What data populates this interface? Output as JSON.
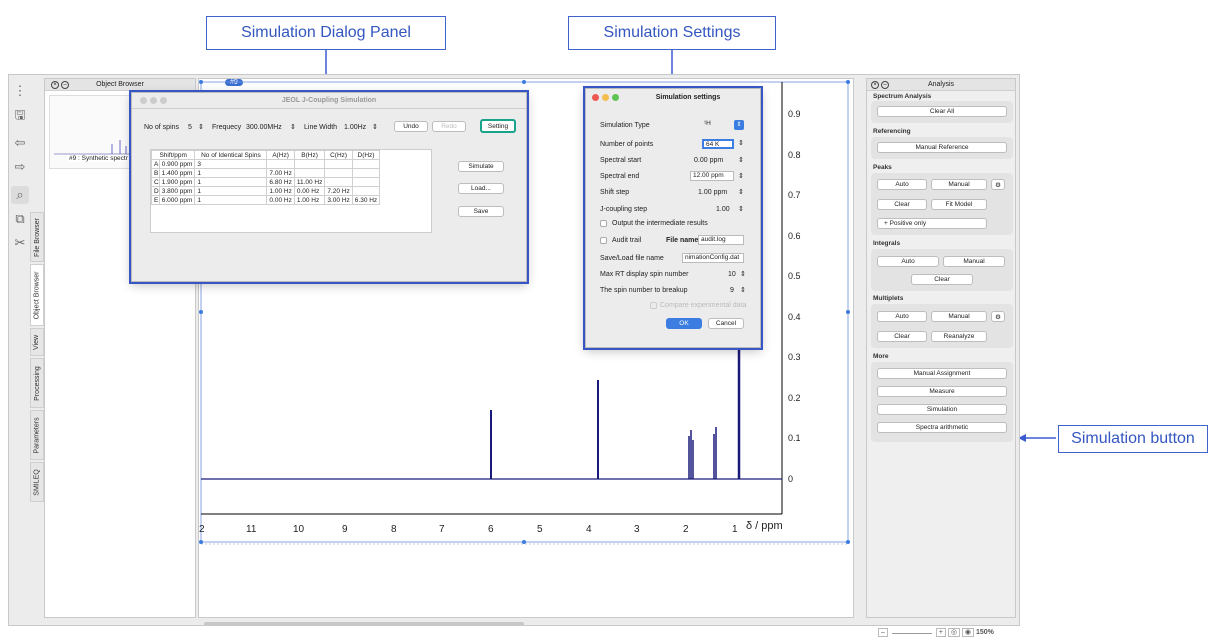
{
  "callouts": {
    "dialog": "Simulation Dialog Panel",
    "settings": "Simulation Settings",
    "button": "Simulation button"
  },
  "toolbar": {
    "icons": [
      "more-vertical-icon",
      "save-icon",
      "undo-icon",
      "redo-icon",
      "zoom-icon",
      "zoom-region-icon",
      "scissors-icon"
    ]
  },
  "vtabs": [
    "File Browser",
    "Object Browser",
    "View",
    "Processing",
    "Parameters",
    "SMILEQ"
  ],
  "object_browser": {
    "title": "Object Browser",
    "item": "#9 : Synthetic spectr"
  },
  "spectrum": {
    "tab": "#9",
    "x_label": "δ / ppm",
    "x_ticks": [
      "2",
      "11",
      "10",
      "9",
      "8",
      "7",
      "6",
      "5",
      "4",
      "3",
      "2",
      "1"
    ],
    "y_ticks": [
      "0.9",
      "0.8",
      "0.7",
      "0.6",
      "0.5",
      "0.4",
      "0.3",
      "0.2",
      "0.1",
      "0"
    ]
  },
  "jdialog": {
    "title": "JEOL J-Coupling Simulation",
    "spins_label": "No of spins",
    "spins": "5",
    "freq_label": "Frequecy",
    "freq": "300.00MHz",
    "lw_label": "Line Width",
    "lw": "1.00Hz",
    "undo": "Undo",
    "redo": "Redo",
    "setting": "Setting",
    "headers": [
      "Shift/ppm",
      "No of Identical Spins",
      "A(Hz)",
      "B(Hz)",
      "C(Hz)",
      "D(Hz)"
    ],
    "rows": [
      [
        "A",
        "0.900 ppm",
        "3",
        "",
        "",
        "",
        ""
      ],
      [
        "B",
        "1.400 ppm",
        "1",
        "7.00 Hz",
        "",
        "",
        ""
      ],
      [
        "C",
        "1.900 ppm",
        "1",
        "6.80 Hz",
        "11.00 Hz",
        "",
        ""
      ],
      [
        "D",
        "3.800 ppm",
        "1",
        "1.00 Hz",
        "0.00 Hz",
        "7.20 Hz",
        ""
      ],
      [
        "E",
        "6.000 ppm",
        "1",
        "0.00 Hz",
        "1.00 Hz",
        "3.00 Hz",
        "6.30 Hz"
      ]
    ],
    "simulate": "Simulate",
    "load": "Load...",
    "save": "Save"
  },
  "settings": {
    "title": "Simulation settings",
    "sim_type_label": "Simulation Type",
    "sim_type": "¹H",
    "points_label": "Number of points",
    "points": "64 K",
    "start_label": "Spectral start",
    "start": "0.00 ppm",
    "end_label": "Spectral end",
    "end": "12.00 ppm",
    "shift_label": "Shift step",
    "shift": "1.00 ppm",
    "jstep_label": "J-coupling step",
    "jstep": "1.00",
    "output_label": "Output the intermediate results",
    "audit_label": "Audit trail",
    "file_label": "File name",
    "file": "audit.log",
    "saveload_label": "Save/Load file name",
    "saveload": "nimationConfig.dat",
    "maxrt_label": "Max RT display spin number",
    "maxrt": "10",
    "breakup_label": "The spin number to breakup",
    "breakup": "9",
    "compare_label": "Compare experimental data",
    "ok": "OK",
    "cancel": "Cancel"
  },
  "analysis": {
    "title": "Analysis",
    "spectrum_analysis": "Spectrum Analysis",
    "clear_all": "Clear All",
    "referencing": "Referencing",
    "manual_reference": "Manual Reference",
    "peaks": "Peaks",
    "peaks_auto": "Auto",
    "peaks_manual": "Manual",
    "peaks_clear": "Clear",
    "fit_model": "Fit Model",
    "positive_only": "+ Positive only",
    "integrals": "Integrals",
    "int_auto": "Auto",
    "int_manual": "Manual",
    "int_clear": "Clear",
    "multiplets": "Multiplets",
    "mul_auto": "Auto",
    "mul_manual": "Manual",
    "mul_clear": "Clear",
    "reanalyze": "Reanalyze",
    "more": "More",
    "manual_assignment": "Manual Assignment",
    "measure": "Measure",
    "simulation": "Simulation",
    "spectra_arithmetic": "Spectra arithmetic"
  },
  "status": {
    "zoom": "150%"
  },
  "colors": {
    "accent": "#3b5bd0",
    "spectrum": "#1a1a7a",
    "teal": "#19a38a"
  }
}
